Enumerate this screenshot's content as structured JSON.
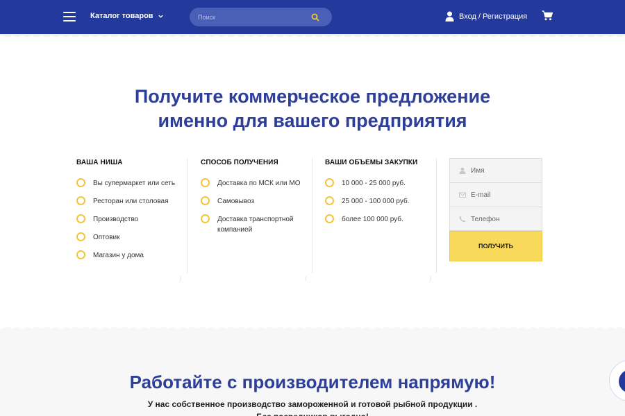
{
  "header": {
    "catalog_label": "Каталог товаров",
    "search_placeholder": "Поиск",
    "login_label": "Вход",
    "login_sep": "/",
    "register_label": "Регистрация"
  },
  "hero": {
    "title_line1": "Получите коммерческое предложение",
    "title_line2": "именно для вашего предприятия"
  },
  "columns": [
    {
      "heading": "Ваша ниша",
      "options": [
        "Вы супермаркет или сеть",
        "Ресторан или столовая",
        "Производство",
        "Оптовик",
        "Магазин у дома"
      ]
    },
    {
      "heading": "Способ получения",
      "options": [
        "Доставка по МСК или МО",
        "Самовывоз",
        "Доставка транспортной компанией"
      ]
    },
    {
      "heading": "Ваши объемы закупки",
      "options": [
        "10 000 - 25 000 руб.",
        "25 000 - 100 000 руб.",
        "более 100 000 руб."
      ]
    }
  ],
  "form": {
    "name_placeholder": "Имя",
    "email_placeholder": "E-mail",
    "phone_placeholder": "Телефон",
    "submit_label": "Получить"
  },
  "bottom": {
    "title": "Работайте с производителем напрямую!",
    "line1": "У нас собственное производство замороженной и готовой рыбной продукции .",
    "line2": "Без посредников выгодно!"
  },
  "icons": {
    "menu": "hamburger-icon",
    "chevron": "chevron-down-icon",
    "search": "search-icon",
    "user": "user-icon",
    "cart": "cart-icon"
  },
  "colors": {
    "header_bg": "#23399b",
    "accent_blue": "#2d3f99",
    "accent_yellow": "#f8d95a"
  }
}
